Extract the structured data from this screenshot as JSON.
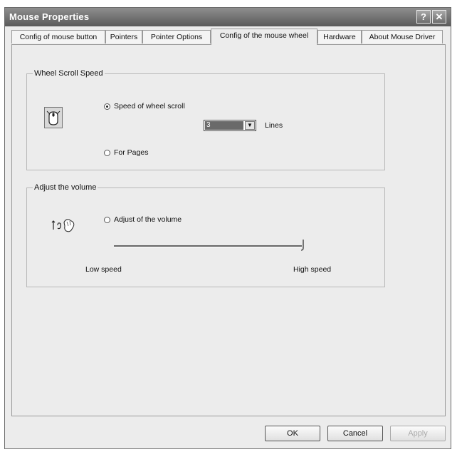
{
  "window": {
    "title": "Mouse Properties",
    "help_label": "?",
    "close_label": "✕"
  },
  "tabs": [
    {
      "label": "Config of mouse button"
    },
    {
      "label": "Pointers"
    },
    {
      "label": "Pointer Options"
    },
    {
      "label": "Config of the mouse wheel"
    },
    {
      "label": "Hardware"
    },
    {
      "label": "About Mouse Driver"
    }
  ],
  "wheel_group": {
    "label": "Wheel Scroll Speed",
    "speed_option": "Speed of wheel scroll",
    "lines_value": "3",
    "lines_label": "Lines",
    "pages_option": "For Pages"
  },
  "volume_group": {
    "label": "Adjust the volume",
    "volume_option": "Adjust of the volume",
    "low_label": "Low speed",
    "high_label": "High speed",
    "slider_value": 1.0
  },
  "buttons": {
    "ok": "OK",
    "cancel": "Cancel",
    "apply": "Apply"
  }
}
